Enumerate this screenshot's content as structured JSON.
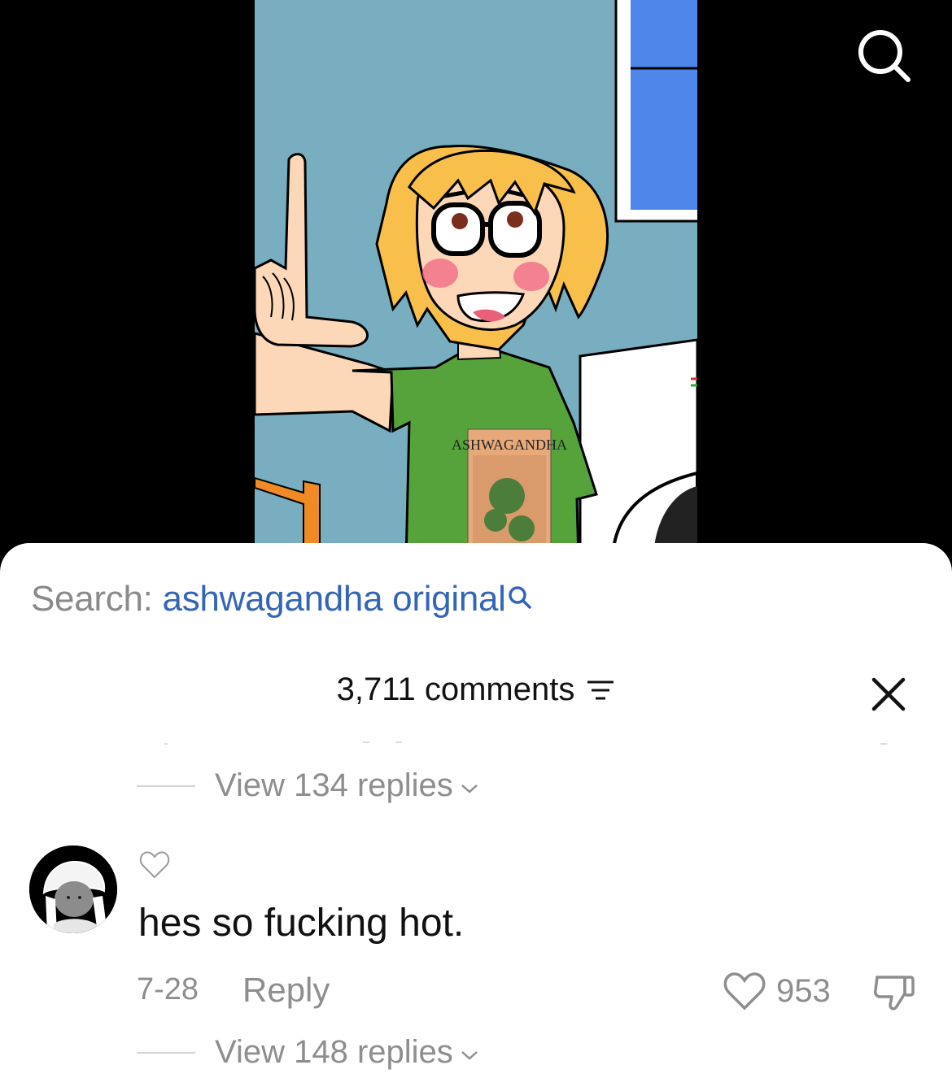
{
  "search": {
    "prefix": "Search:",
    "query": "ashwagandha original"
  },
  "comments_header": {
    "count_label": "3,711 comments"
  },
  "video": {
    "shirt_text": "ASHWAGANDHA"
  },
  "threads": [
    {
      "view_replies": "View 134 replies"
    },
    {
      "comment": "hes so fucking hot.",
      "date": "7-28",
      "reply_label": "Reply",
      "likes": "953",
      "view_replies": "View 148 replies"
    }
  ],
  "colors": {
    "query_link": "#3565b5",
    "muted_text": "#8e8e8e",
    "sheet_bg": "#ffffff",
    "video_bg": "#000000"
  },
  "icons": [
    "search-icon",
    "magnifier-icon",
    "sort-icon",
    "close-icon",
    "chevron-down-icon",
    "heart-icon",
    "dislike-icon"
  ]
}
